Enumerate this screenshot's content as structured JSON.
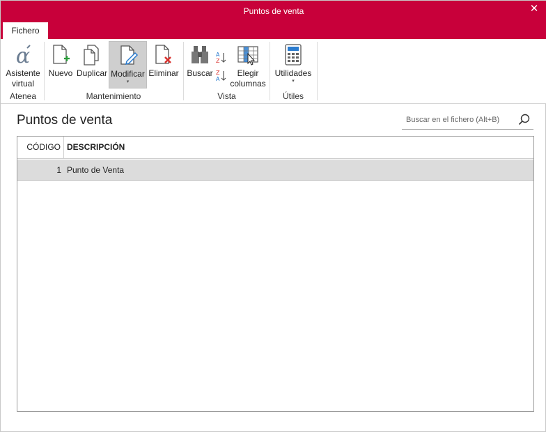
{
  "window": {
    "title": "Puntos de venta",
    "close_label": "✕"
  },
  "tabs": [
    {
      "label": "Fichero"
    }
  ],
  "ribbon": {
    "groups": [
      {
        "label": "Atenea",
        "buttons": [
          {
            "label": "Asistente virtual",
            "icon": "alpha-icon"
          }
        ]
      },
      {
        "label": "Mantenimiento",
        "buttons": [
          {
            "label": "Nuevo",
            "icon": "new-document-icon"
          },
          {
            "label": "Duplicar",
            "icon": "duplicate-icon"
          },
          {
            "label": "Modificar",
            "icon": "edit-document-icon",
            "active": true,
            "caret": "▾"
          },
          {
            "label": "Eliminar",
            "icon": "delete-document-icon"
          }
        ]
      },
      {
        "label": "Vista",
        "buttons": [
          {
            "label": "Buscar",
            "icon": "binoculars-icon"
          },
          {
            "label": "",
            "icon": "sort-az-icon"
          },
          {
            "label": "",
            "icon": "sort-za-icon"
          },
          {
            "label": "Elegir columnas",
            "icon": "columns-icon"
          }
        ]
      },
      {
        "label": "Útiles",
        "buttons": [
          {
            "label": "Utilidades",
            "icon": "calculator-icon",
            "caret": "▾"
          }
        ]
      }
    ]
  },
  "main": {
    "title": "Puntos de venta",
    "search": {
      "placeholder": "Buscar en el fichero (Alt+B)"
    },
    "table": {
      "columns": [
        "CÓDIGO",
        "DESCRIPCIÓN"
      ],
      "rows": [
        {
          "code": "1",
          "description": "Punto de Venta"
        }
      ]
    }
  },
  "colors": {
    "accent": "#c8003a",
    "selected_row": "#dcdcdc"
  }
}
